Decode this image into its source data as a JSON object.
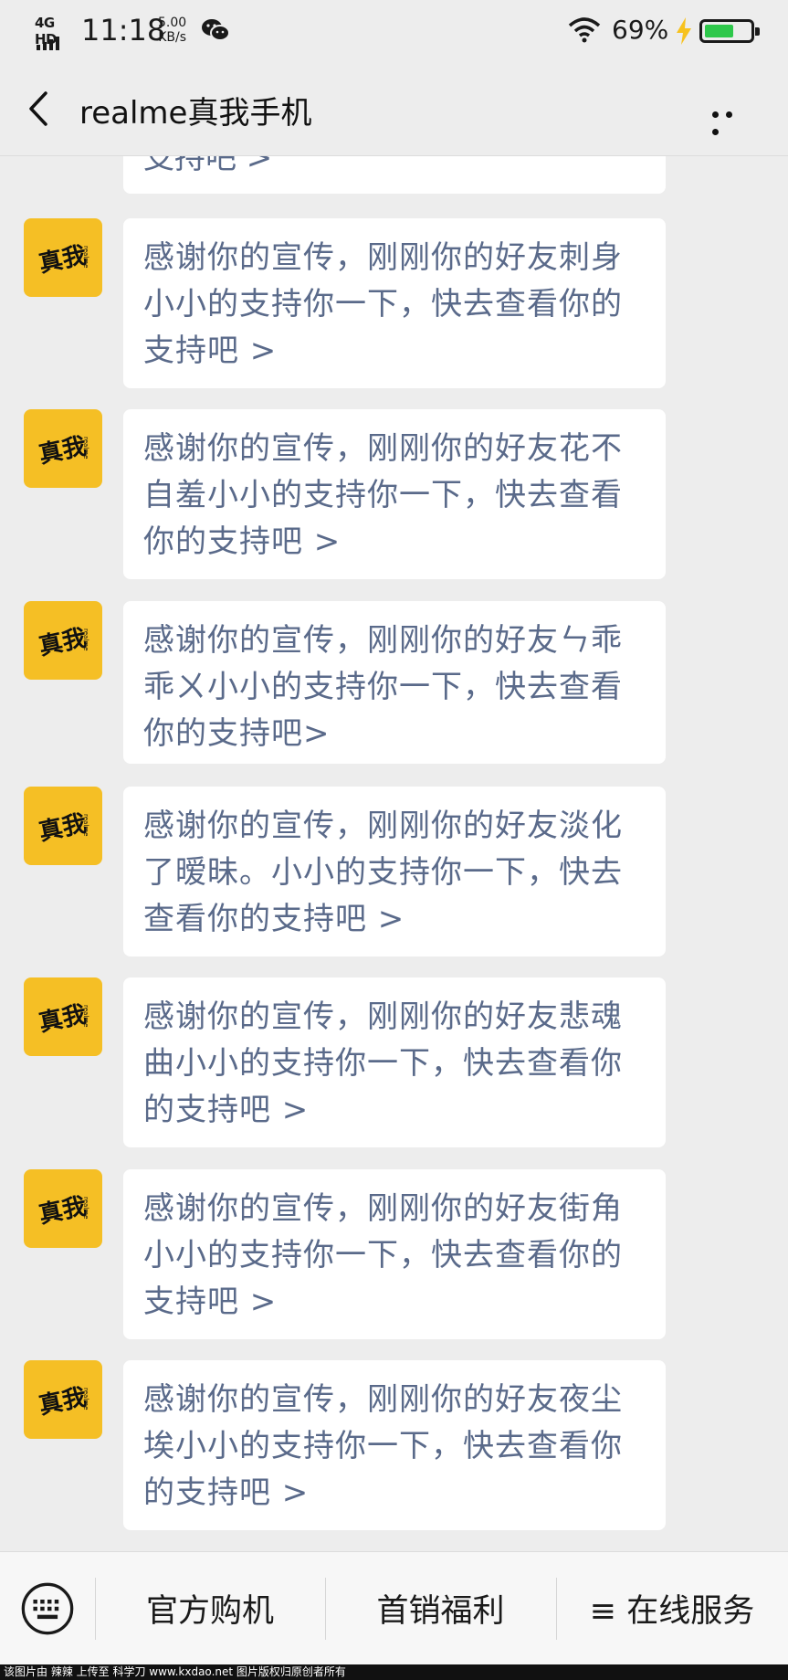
{
  "status_bar": {
    "network": "4G HD",
    "time": "11:18",
    "speed_value": "5.00",
    "speed_unit": "KB/s",
    "battery_percent": "69%",
    "battery_level": 0.69,
    "battery_color": "#2ec84b"
  },
  "header": {
    "title": "realme真我手机",
    "back_icon": "chevron-left-icon",
    "more_icon": "more-dots-icon"
  },
  "chat": {
    "partial_top_text": "支持吧 >",
    "avatar_glyph": "真我",
    "avatar_brand": "realme",
    "avatar_color": "#f5bf25",
    "messages": [
      {
        "lines": [
          "感谢你的宣传，刚刚你的好友刺身",
          "小小的支持你一下，快去查看你的",
          "支持吧 >"
        ]
      },
      {
        "lines": [
          "感谢你的宣传，刚刚你的好友花不",
          "自羞小小的支持你一下，快去查看",
          "你的支持吧 >"
        ]
      },
      {
        "lines": [
          "感谢你的宣传，刚刚你的好友ㄣ乖",
          "乖ㄨ小小的支持你一下，快去查看",
          "你的支持吧>"
        ]
      },
      {
        "lines": [
          "感谢你的宣传，刚刚你的好友淡化",
          "了暧昧。小小的支持你一下，快去",
          "查看你的支持吧 >"
        ]
      },
      {
        "lines": [
          "感谢你的宣传，刚刚你的好友悲魂",
          "曲小小的支持你一下，快去查看你",
          "的支持吧 >"
        ]
      },
      {
        "lines": [
          "感谢你的宣传，刚刚你的好友街角",
          "小小的支持你一下，快去查看你的",
          "支持吧 >"
        ]
      },
      {
        "lines": [
          "感谢你的宣传，刚刚你的好友夜尘",
          "埃小小的支持你一下，快去查看你",
          "的支持吧 >"
        ]
      }
    ]
  },
  "bottom_menu": {
    "keyboard_icon": "keyboard-icon",
    "items": [
      "官方购机",
      "首销福利",
      "≡ 在线服务"
    ]
  },
  "watermark": "该图片由 辣辣 上传至 科学刀 www.kxdao.net 图片版权归原创者所有"
}
